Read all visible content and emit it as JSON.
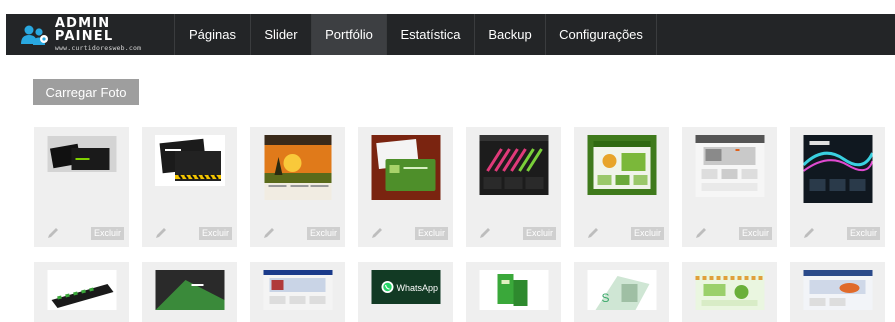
{
  "brand": {
    "title": "ADMIN PAINEL",
    "subtitle": "www.curtidoresweb.com",
    "icon": "admin-users-icon",
    "accent": "#29a8e0"
  },
  "nav": [
    {
      "label": "Páginas",
      "active": false
    },
    {
      "label": "Slider",
      "active": false
    },
    {
      "label": "Portfólio",
      "active": true
    },
    {
      "label": "Estatística",
      "active": false
    },
    {
      "label": "Backup",
      "active": false
    },
    {
      "label": "Configurações",
      "active": false
    }
  ],
  "upload_button": "Carregar Foto",
  "card_actions": {
    "edit_icon": "pencil-icon",
    "delete_label": "Excluir"
  },
  "row2": {
    "whatsapp_label": "WhatsApp"
  },
  "colors": {
    "navbar": "#232527",
    "active_nav": "#3d3f42",
    "card_bg": "#efefef",
    "button": "#9e9e9e"
  }
}
